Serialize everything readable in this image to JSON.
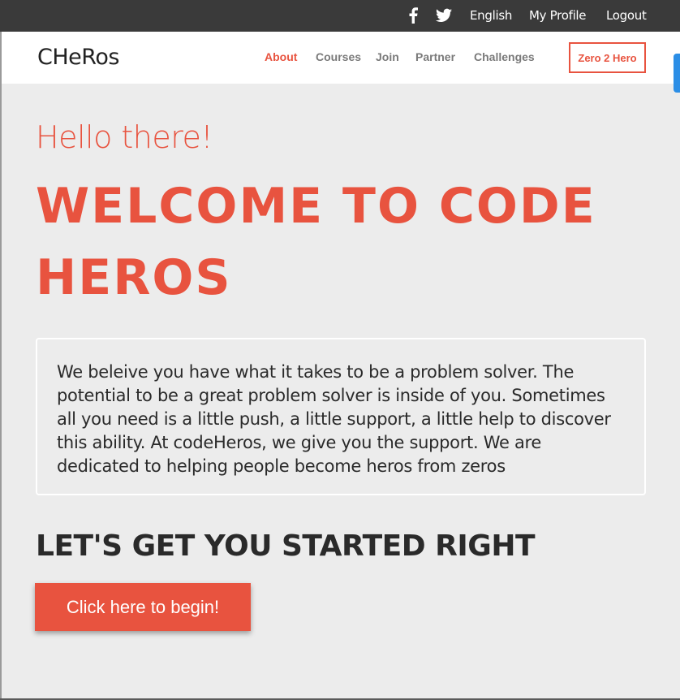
{
  "topbar": {
    "icons": [
      "facebook-icon",
      "twitter-icon"
    ],
    "links": [
      {
        "label": "English"
      },
      {
        "label": "My Profile"
      },
      {
        "label": "Logout"
      }
    ]
  },
  "navbar": {
    "brand": "CHeRos",
    "links": [
      {
        "label": "About",
        "active": true
      },
      {
        "label": "Courses",
        "active": false
      },
      {
        "label": "Join",
        "active": false
      },
      {
        "label": "Partner",
        "active": false
      },
      {
        "label": "Challenges",
        "active": false
      }
    ],
    "cta_label": "Zero 2 Hero"
  },
  "hero": {
    "greeting": "Hello there!",
    "title": "WELCOME TO CODE HEROS",
    "intro": "We beleive you have what it takes to be a problem solver. The potential to be a great problem solver is inside of you. Sometimes all you need is a little push, a little support, a little help to discover this ability. At codeHeros, we give you the support. We are dedicated to helping people become heros from zeros",
    "cta_heading": "LET'S GET YOU STARTED RIGHT",
    "cta_button": "Click here to begin!"
  },
  "colors": {
    "accent": "#e8533f",
    "topbar_bg": "#3a3a3a",
    "page_bg": "#ececec",
    "side_tab": "#2b8ee6"
  }
}
